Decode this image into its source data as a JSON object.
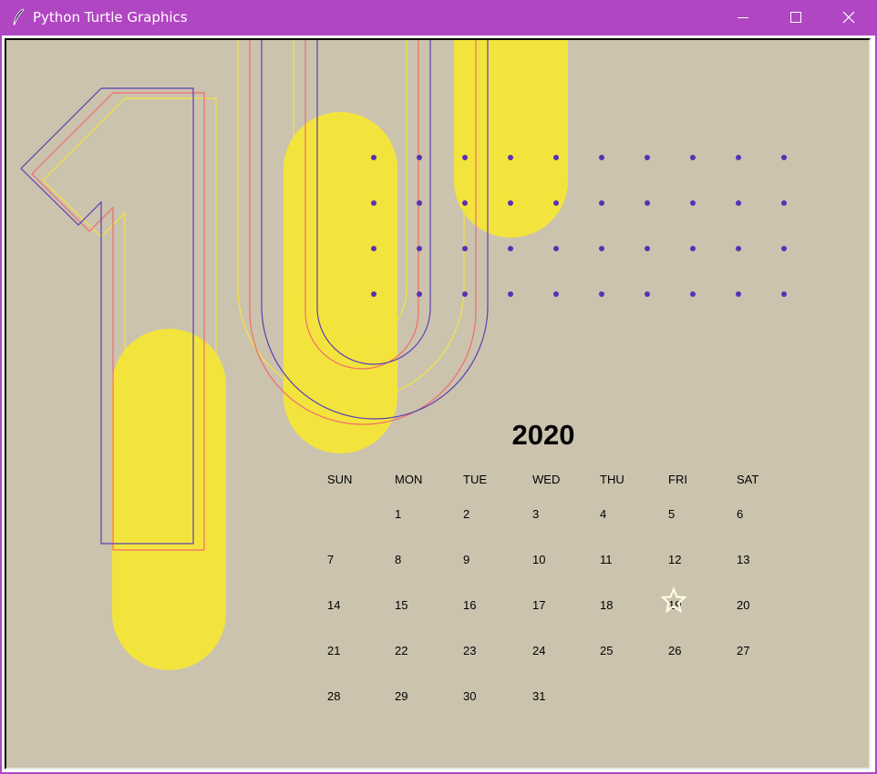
{
  "window": {
    "title": "Python Turtle Graphics",
    "app_icon": "feather-pen-icon",
    "controls": [
      "minimize-icon",
      "maximize-icon",
      "close-icon"
    ],
    "titlebar_color": "#b146c2"
  },
  "canvas": {
    "background_color": "#cbc3ae",
    "accent_yellow": "#f3e43d",
    "dot_color": "#5a2fb4",
    "outline_colors": [
      "#5a3fb4",
      "#f26c6c",
      "#f3e43d"
    ]
  },
  "calendar": {
    "year": "2020",
    "weekdays": [
      "SUN",
      "MON",
      "TUE",
      "WED",
      "THU",
      "FRI",
      "SAT"
    ],
    "weeks": [
      [
        "",
        "1",
        "2",
        "3",
        "4",
        "5",
        "6"
      ],
      [
        "7",
        "8",
        "9",
        "10",
        "11",
        "12",
        "13"
      ],
      [
        "14",
        "15",
        "16",
        "17",
        "18",
        "19",
        "20"
      ],
      [
        "21",
        "22",
        "23",
        "24",
        "25",
        "26",
        "27"
      ],
      [
        "28",
        "29",
        "30",
        "31",
        "",
        "",
        ""
      ]
    ],
    "highlighted_day": "19",
    "highlight_icon": "star-icon"
  }
}
